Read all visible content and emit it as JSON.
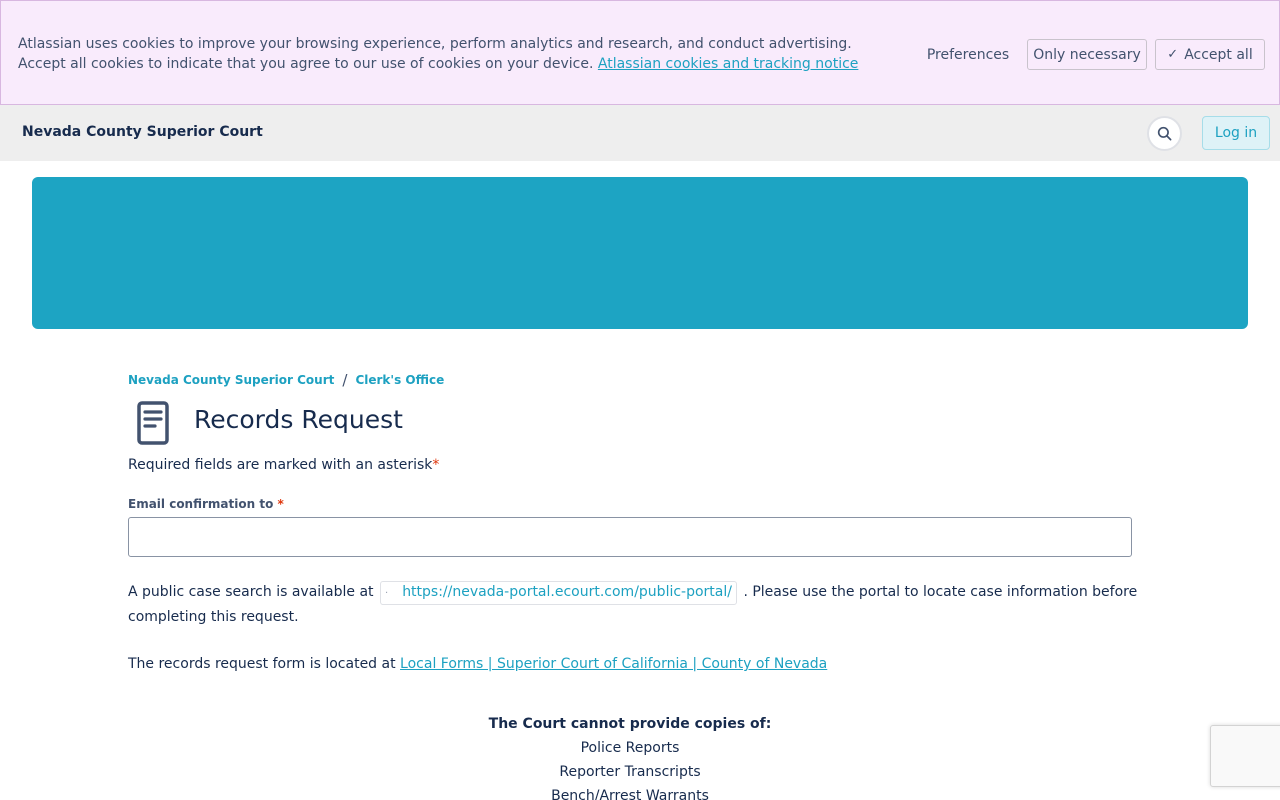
{
  "cookie_banner": {
    "text": "Atlassian uses cookies to improve your browsing experience, perform analytics and research, and conduct advertising. Accept all cookies to indicate that you agree to our use of cookies on your device.",
    "link_text": "Atlassian cookies and tracking notice",
    "preferences_label": "Preferences",
    "only_necessary_label": "Only necessary",
    "accept_all_label": "Accept all"
  },
  "header": {
    "site_name": "Nevada County Superior Court",
    "search_icon": "search-icon",
    "login_label": "Log in"
  },
  "breadcrumb": {
    "items": [
      "Nevada County Superior Court",
      "Clerk's Office"
    ],
    "separator": "/"
  },
  "form": {
    "icon": "document-form-icon",
    "title": "Records Request",
    "required_note": "Required fields are marked with an asterisk",
    "asterisk": "*",
    "email_label": "Email confirmation to",
    "email_value": ""
  },
  "content": {
    "para1_prefix": "A public case search is available at",
    "portal_link": "https://nevada-portal.ecourt.com/public-portal/",
    "para1_suffix": ". Please use the portal to locate case information before completing this request.",
    "para2_prefix": "The records request form is located at",
    "forms_link": "Local Forms | Superior Court of California | County of Nevada",
    "cannot_provide_heading": "The Court cannot provide copies of:",
    "cannot_provide_items": [
      "Police Reports",
      "Reporter Transcripts",
      "Bench/Arrest Warrants"
    ]
  },
  "colors": {
    "accent": "#1da1c1",
    "banner": "#1da4c3",
    "cookie_bg": "#f9ebfc",
    "header_bg": "#eeeeee",
    "text": "#172b4d"
  }
}
